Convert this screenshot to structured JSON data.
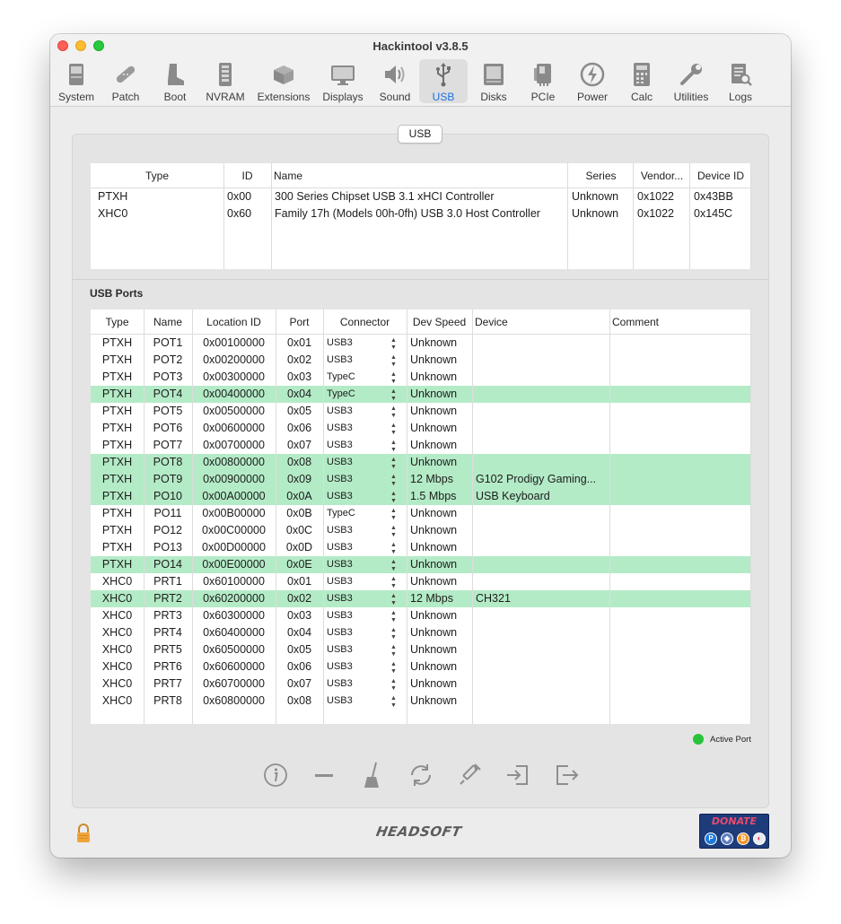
{
  "window": {
    "title": "Hackintool v3.8.5"
  },
  "toolbar": {
    "active": "USB",
    "items": [
      {
        "label": "System",
        "icon": "system-icon"
      },
      {
        "label": "Patch",
        "icon": "patch-icon"
      },
      {
        "label": "Boot",
        "icon": "boot-icon"
      },
      {
        "label": "NVRAM",
        "icon": "nvram-icon"
      },
      {
        "label": "Extensions",
        "icon": "extensions-icon"
      },
      {
        "label": "Displays",
        "icon": "displays-icon"
      },
      {
        "label": "Sound",
        "icon": "sound-icon"
      },
      {
        "label": "USB",
        "icon": "usb-icon"
      },
      {
        "label": "Disks",
        "icon": "disks-icon"
      },
      {
        "label": "PCIe",
        "icon": "pcie-icon"
      },
      {
        "label": "Power",
        "icon": "power-icon"
      },
      {
        "label": "Calc",
        "icon": "calc-icon"
      },
      {
        "label": "Utilities",
        "icon": "utilities-icon"
      },
      {
        "label": "Logs",
        "icon": "logs-icon"
      }
    ]
  },
  "tab": {
    "label": "USB"
  },
  "controllers": {
    "headers": [
      "Type",
      "ID",
      "Name",
      "Series",
      "Vendor...",
      "Device ID"
    ],
    "rows": [
      [
        "PTXH",
        "0x00",
        "300 Series Chipset USB 3.1 xHCI Controller",
        "Unknown",
        "0x1022",
        "0x43BB"
      ],
      [
        "XHC0",
        "0x60",
        "Family 17h (Models 00h-0fh) USB 3.0 Host Controller",
        "Unknown",
        "0x1022",
        "0x145C"
      ]
    ]
  },
  "ports": {
    "section_title": "USB Ports",
    "headers": [
      "Type",
      "Name",
      "Location ID",
      "Port",
      "Connector",
      "Dev Speed",
      "Device",
      "Comment"
    ],
    "rows": [
      {
        "type": "PTXH",
        "name": "POT1",
        "location": "0x00100000",
        "port": "0x01",
        "connector": "USB3",
        "speed": "Unknown",
        "device": "",
        "comment": "",
        "active": false
      },
      {
        "type": "PTXH",
        "name": "POT2",
        "location": "0x00200000",
        "port": "0x02",
        "connector": "USB3",
        "speed": "Unknown",
        "device": "",
        "comment": "",
        "active": false
      },
      {
        "type": "PTXH",
        "name": "POT3",
        "location": "0x00300000",
        "port": "0x03",
        "connector": "TypeC",
        "speed": "Unknown",
        "device": "",
        "comment": "",
        "active": false
      },
      {
        "type": "PTXH",
        "name": "POT4",
        "location": "0x00400000",
        "port": "0x04",
        "connector": "TypeC",
        "speed": "Unknown",
        "device": "",
        "comment": "",
        "active": true
      },
      {
        "type": "PTXH",
        "name": "POT5",
        "location": "0x00500000",
        "port": "0x05",
        "connector": "USB3",
        "speed": "Unknown",
        "device": "",
        "comment": "",
        "active": false
      },
      {
        "type": "PTXH",
        "name": "POT6",
        "location": "0x00600000",
        "port": "0x06",
        "connector": "USB3",
        "speed": "Unknown",
        "device": "",
        "comment": "",
        "active": false
      },
      {
        "type": "PTXH",
        "name": "POT7",
        "location": "0x00700000",
        "port": "0x07",
        "connector": "USB3",
        "speed": "Unknown",
        "device": "",
        "comment": "",
        "active": false
      },
      {
        "type": "PTXH",
        "name": "POT8",
        "location": "0x00800000",
        "port": "0x08",
        "connector": "USB3",
        "speed": "Unknown",
        "device": "",
        "comment": "",
        "active": true
      },
      {
        "type": "PTXH",
        "name": "POT9",
        "location": "0x00900000",
        "port": "0x09",
        "connector": "USB3",
        "speed": "12 Mbps",
        "device": "G102 Prodigy Gaming...",
        "comment": "",
        "active": true
      },
      {
        "type": "PTXH",
        "name": "PO10",
        "location": "0x00A00000",
        "port": "0x0A",
        "connector": "USB3",
        "speed": "1.5 Mbps",
        "device": "USB Keyboard",
        "comment": "",
        "active": true
      },
      {
        "type": "PTXH",
        "name": "PO11",
        "location": "0x00B00000",
        "port": "0x0B",
        "connector": "TypeC",
        "speed": "Unknown",
        "device": "",
        "comment": "",
        "active": false
      },
      {
        "type": "PTXH",
        "name": "PO12",
        "location": "0x00C00000",
        "port": "0x0C",
        "connector": "USB3",
        "speed": "Unknown",
        "device": "",
        "comment": "",
        "active": false
      },
      {
        "type": "PTXH",
        "name": "PO13",
        "location": "0x00D00000",
        "port": "0x0D",
        "connector": "USB3",
        "speed": "Unknown",
        "device": "",
        "comment": "",
        "active": false
      },
      {
        "type": "PTXH",
        "name": "PO14",
        "location": "0x00E00000",
        "port": "0x0E",
        "connector": "USB3",
        "speed": "Unknown",
        "device": "",
        "comment": "",
        "active": true
      },
      {
        "type": "XHC0",
        "name": "PRT1",
        "location": "0x60100000",
        "port": "0x01",
        "connector": "USB3",
        "speed": "Unknown",
        "device": "",
        "comment": "",
        "active": false
      },
      {
        "type": "XHC0",
        "name": "PRT2",
        "location": "0x60200000",
        "port": "0x02",
        "connector": "USB3",
        "speed": "12 Mbps",
        "device": "CH321",
        "comment": "",
        "active": true
      },
      {
        "type": "XHC0",
        "name": "PRT3",
        "location": "0x60300000",
        "port": "0x03",
        "connector": "USB3",
        "speed": "Unknown",
        "device": "",
        "comment": "",
        "active": false
      },
      {
        "type": "XHC0",
        "name": "PRT4",
        "location": "0x60400000",
        "port": "0x04",
        "connector": "USB3",
        "speed": "Unknown",
        "device": "",
        "comment": "",
        "active": false
      },
      {
        "type": "XHC0",
        "name": "PRT5",
        "location": "0x60500000",
        "port": "0x05",
        "connector": "USB3",
        "speed": "Unknown",
        "device": "",
        "comment": "",
        "active": false
      },
      {
        "type": "XHC0",
        "name": "PRT6",
        "location": "0x60600000",
        "port": "0x06",
        "connector": "USB3",
        "speed": "Unknown",
        "device": "",
        "comment": "",
        "active": false
      },
      {
        "type": "XHC0",
        "name": "PRT7",
        "location": "0x60700000",
        "port": "0x07",
        "connector": "USB3",
        "speed": "Unknown",
        "device": "",
        "comment": "",
        "active": false
      },
      {
        "type": "XHC0",
        "name": "PRT8",
        "location": "0x60800000",
        "port": "0x08",
        "connector": "USB3",
        "speed": "Unknown",
        "device": "",
        "comment": "",
        "active": false
      }
    ]
  },
  "legend": {
    "label": "Active Port",
    "color": "#27c33b"
  },
  "colors": {
    "active_row": "#b4ebc7",
    "accent": "#1c6fe0"
  },
  "actions": [
    "info-icon",
    "remove-icon",
    "clear-icon",
    "refresh-icon",
    "inject-icon",
    "import-icon",
    "export-icon"
  ],
  "footer": {
    "brand": "HEADSOFT",
    "donate": "DONATE",
    "donate_coins": [
      "paypal-icon",
      "ethereum-icon",
      "bitcoin-icon",
      "other-coin-icon"
    ]
  }
}
